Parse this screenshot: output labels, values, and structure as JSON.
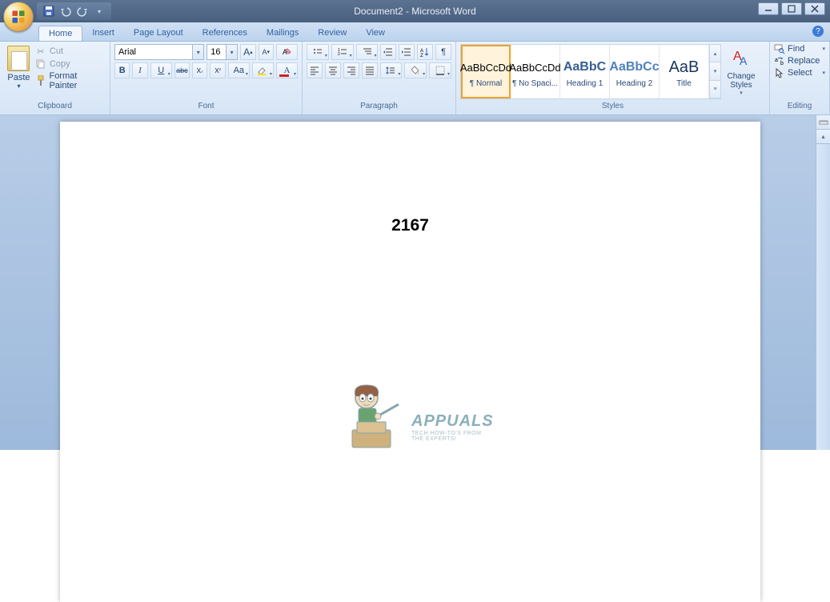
{
  "title": "Document2 - Microsoft Word",
  "qat": {
    "save": "save",
    "undo": "undo",
    "redo": "redo"
  },
  "tabs": [
    {
      "label": "Home",
      "active": true
    },
    {
      "label": "Insert",
      "active": false
    },
    {
      "label": "Page Layout",
      "active": false
    },
    {
      "label": "References",
      "active": false
    },
    {
      "label": "Mailings",
      "active": false
    },
    {
      "label": "Review",
      "active": false
    },
    {
      "label": "View",
      "active": false
    }
  ],
  "clipboard": {
    "label": "Clipboard",
    "paste": "Paste",
    "cut": "Cut",
    "copy": "Copy",
    "format_painter": "Format Painter"
  },
  "font": {
    "label": "Font",
    "name": "Arial",
    "size": "16"
  },
  "paragraph": {
    "label": "Paragraph"
  },
  "styles": {
    "label": "Styles",
    "items": [
      {
        "preview": "AaBbCcDd",
        "name": "¶ Normal",
        "selected": true,
        "color": "#000",
        "font": "normal"
      },
      {
        "preview": "AaBbCcDd",
        "name": "¶ No Spaci...",
        "selected": false,
        "color": "#000",
        "font": "normal"
      },
      {
        "preview": "AaBbC",
        "name": "Heading 1",
        "selected": false,
        "color": "#365f91",
        "font": "bold"
      },
      {
        "preview": "AaBbCc",
        "name": "Heading 2",
        "selected": false,
        "color": "#4f81bd",
        "font": "bold"
      },
      {
        "preview": "AaB",
        "name": "Title",
        "selected": false,
        "color": "#17365d",
        "font": "normal"
      }
    ],
    "change": "Change Styles"
  },
  "editing": {
    "label": "Editing",
    "find": "Find",
    "replace": "Replace",
    "select": "Select"
  },
  "document": {
    "content": "2167"
  },
  "watermark": {
    "title": "APPUALS",
    "sub1": "TECH HOW-TO'S FROM",
    "sub2": "THE EXPERTS!"
  }
}
